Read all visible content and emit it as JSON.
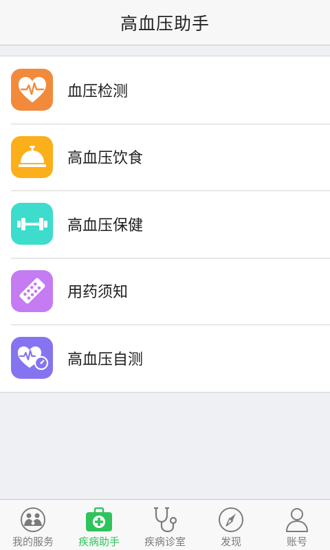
{
  "header": {
    "title": "高血压助手"
  },
  "menu": {
    "items": [
      {
        "label": "血压检测",
        "icon": "heart-pulse-icon",
        "color": "#f28a3c"
      },
      {
        "label": "高血压饮食",
        "icon": "service-bell-icon",
        "color": "#fbaf1a"
      },
      {
        "label": "高血压保健",
        "icon": "dumbbell-icon",
        "color": "#3ddccc"
      },
      {
        "label": "用药须知",
        "icon": "pill-strip-icon",
        "color": "#c57bf2"
      },
      {
        "label": "高血压自测",
        "icon": "heart-gauge-icon",
        "color": "#8574f0"
      }
    ]
  },
  "tabbar": {
    "active_color": "#2fc35c",
    "inactive_color": "#7b7b7b",
    "tabs": [
      {
        "label": "我的服务",
        "icon": "family-icon",
        "active": false
      },
      {
        "label": "疾病助手",
        "icon": "medical-kit-icon",
        "active": true
      },
      {
        "label": "疾病诊室",
        "icon": "stethoscope-icon",
        "active": false
      },
      {
        "label": "发现",
        "icon": "compass-icon",
        "active": false
      },
      {
        "label": "账号",
        "icon": "user-icon",
        "active": false
      }
    ]
  }
}
